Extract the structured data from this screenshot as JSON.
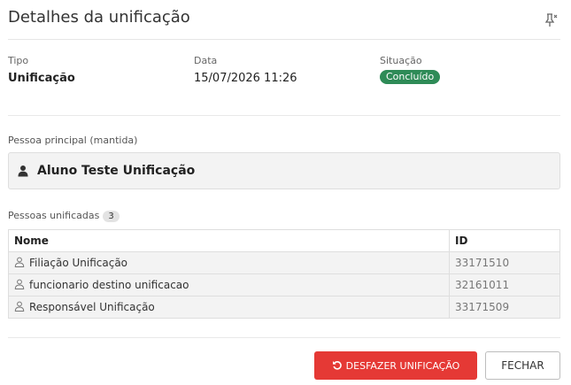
{
  "dialog": {
    "title": "Detalhes da unificação"
  },
  "info": {
    "tipo_label": "Tipo",
    "tipo_value": "Unificação",
    "data_label": "Data",
    "data_value": "15/07/2026 11:26",
    "situacao_label": "Situação",
    "situacao_value": "Concluído"
  },
  "main_person": {
    "label": "Pessoa principal (mantida)",
    "name": "Aluno Teste Unificação"
  },
  "unified": {
    "label": "Pessoas unificadas",
    "count": "3",
    "columns": {
      "name": "Nome",
      "id": "ID"
    },
    "rows": [
      {
        "name": "Filiação Unificação",
        "id": "33171510"
      },
      {
        "name": "funcionario destino unificacao",
        "id": "32161011"
      },
      {
        "name": "Responsável Unificação",
        "id": "33171509"
      }
    ]
  },
  "actions": {
    "undo_label": "DESFAZER UNIFICAÇÃO",
    "close_label": "FECHAR"
  },
  "colors": {
    "status_success": "#2e8b57",
    "danger": "#e53935"
  },
  "icons": {
    "unpin": "unpin-icon",
    "person": "user-icon",
    "undo": "undo-icon"
  }
}
